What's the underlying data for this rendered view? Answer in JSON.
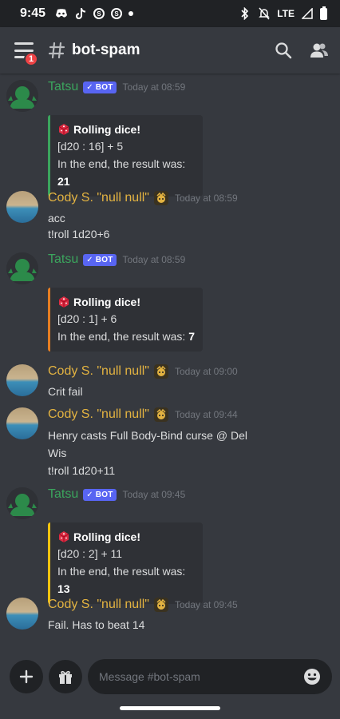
{
  "status_bar": {
    "time": "9:45",
    "network": "LTE"
  },
  "header": {
    "notification_count": "1",
    "channel": "bot-spam"
  },
  "messages": [
    {
      "author": "Tatsu",
      "bot_tag": "✓ BOT",
      "timestamp": "Today at 08:59",
      "embed": {
        "title": "Rolling dice!",
        "line1": "[d20 : 16] + 5",
        "result_prefix": "In the end, the result was: ",
        "result": "21",
        "color": "#3ba55d"
      }
    },
    {
      "author": "Cody S. \"null null\"",
      "timestamp": "Today at 08:59",
      "lines": [
        "acc",
        "t!roll 1d20+6"
      ]
    },
    {
      "author": "Tatsu",
      "bot_tag": "✓ BOT",
      "timestamp": "Today at 08:59",
      "embed": {
        "title": "Rolling dice!",
        "line1": "[d20 : 1] + 6",
        "result_prefix": "In the end, the result was: ",
        "result": "7",
        "color": "#e67e22"
      }
    },
    {
      "author": "Cody S. \"null null\"",
      "timestamp": "Today at 09:00",
      "lines": [
        "Crit fail"
      ]
    },
    {
      "author": "Cody S. \"null null\"",
      "timestamp": "Today at 09:44",
      "lines": [
        "Henry casts Full Body-Bind curse @ Del",
        "Wis",
        "t!roll 1d20+11"
      ]
    },
    {
      "author": "Tatsu",
      "bot_tag": "✓ BOT",
      "timestamp": "Today at 09:45",
      "embed": {
        "title": "Rolling dice!",
        "line1": "[d20 : 2] + 11",
        "result_prefix": "In the end, the result was: ",
        "result": "13",
        "color": "#f1c40f"
      }
    },
    {
      "author": "Cody S. \"null null\"",
      "timestamp": "Today at 09:45",
      "lines": [
        "Fail. Has to beat 14"
      ]
    }
  ],
  "input": {
    "placeholder": "Message #bot-spam"
  },
  "colors": {
    "background": "#36393f",
    "bot_tag": "#5865f2",
    "tatsu_name": "#3ba55d",
    "cody_name": "#e3b341"
  }
}
